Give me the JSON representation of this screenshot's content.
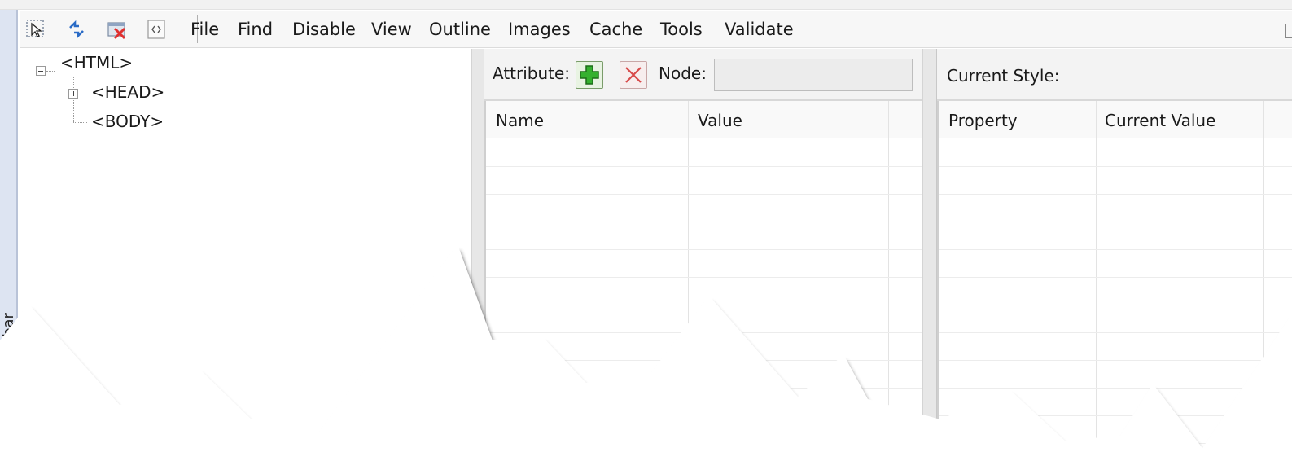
{
  "toolbar": {
    "icons": [
      "select-element-icon",
      "refresh-icon",
      "clear-icon",
      "view-source-icon"
    ],
    "menu": [
      "File",
      "Find",
      "Disable",
      "View",
      "Outline",
      "Images",
      "Cache",
      "Tools",
      "Validate"
    ]
  },
  "side_strip": {
    "label": "olbar"
  },
  "tree": {
    "nodes": [
      {
        "label": "<HTML>",
        "expanded": true
      },
      {
        "label": "<HEAD>",
        "expanded": false
      },
      {
        "label": "<BODY>",
        "expanded": null
      }
    ]
  },
  "attributes": {
    "label": "Attribute:",
    "node_label": "Node:",
    "node_value": "",
    "columns": [
      "Name",
      "Value"
    ]
  },
  "style": {
    "label": "Current Style:",
    "columns": [
      "Property",
      "Current Value"
    ]
  },
  "colors": {
    "accent_add": "#2fa22a",
    "accent_delete": "#d23a3a",
    "side_strip": "#dde4f2"
  }
}
